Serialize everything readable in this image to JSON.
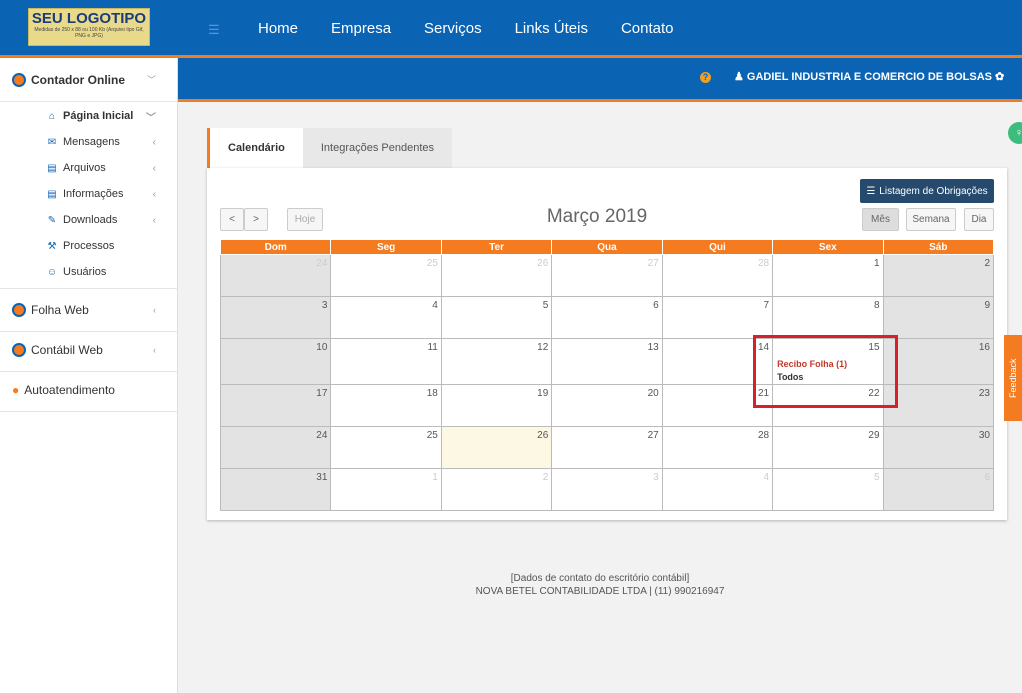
{
  "logo": {
    "title": "SEU LOGOTIPO",
    "subtitle": "Medidas de 250 x 88 ou 100 Kb (Arquivo tipo Gif, PNG e JPG)"
  },
  "topnav": {
    "items": [
      "Home",
      "Empresa",
      "Serviços",
      "Links Úteis",
      "Contato"
    ]
  },
  "header": {
    "user": "GADIEL INDUSTRIA E COMERCIO DE BOLSAS"
  },
  "sidebar": {
    "main1": "Contador Online",
    "subs": [
      "Página Inicial",
      "Mensagens",
      "Arquivos",
      "Informações",
      "Downloads",
      "Processos",
      "Usuários"
    ],
    "main2": "Folha Web",
    "main3": "Contábil Web",
    "main4": "Autoatendimento"
  },
  "tabs": [
    "Calendário",
    "Integrações Pendentes"
  ],
  "calendar": {
    "title": "Março 2019",
    "list_button": "Listagem de Obrigações",
    "today_button": "Hoje",
    "prev": "<",
    "next": ">",
    "views": [
      "Mês",
      "Semana",
      "Dia"
    ],
    "weekdays": [
      "Dom",
      "Seg",
      "Ter",
      "Qua",
      "Qui",
      "Sex",
      "Sáb"
    ],
    "weeks": [
      [
        "24",
        "25",
        "26",
        "27",
        "28",
        "1",
        "2"
      ],
      [
        "3",
        "4",
        "5",
        "6",
        "7",
        "8",
        "9"
      ],
      [
        "10",
        "11",
        "12",
        "13",
        "14",
        "15",
        "16"
      ],
      [
        "17",
        "18",
        "19",
        "20",
        "21",
        "22",
        "23"
      ],
      [
        "24",
        "25",
        "26",
        "27",
        "28",
        "29",
        "30"
      ],
      [
        "31",
        "1",
        "2",
        "3",
        "4",
        "5",
        "6"
      ]
    ],
    "event": {
      "title": "Recibo Folha (1)",
      "subtitle": "Todos"
    }
  },
  "footer": {
    "line1": "[Dados de contato do escritório contábil]",
    "line2": "NOVA BETEL CONTABILIDADE LTDA | (11) 990216947"
  },
  "feedback": "Feedback",
  "colors": {
    "brand": "#0b63b4",
    "accent": "#f47b20",
    "highlight": "#d8202a"
  }
}
